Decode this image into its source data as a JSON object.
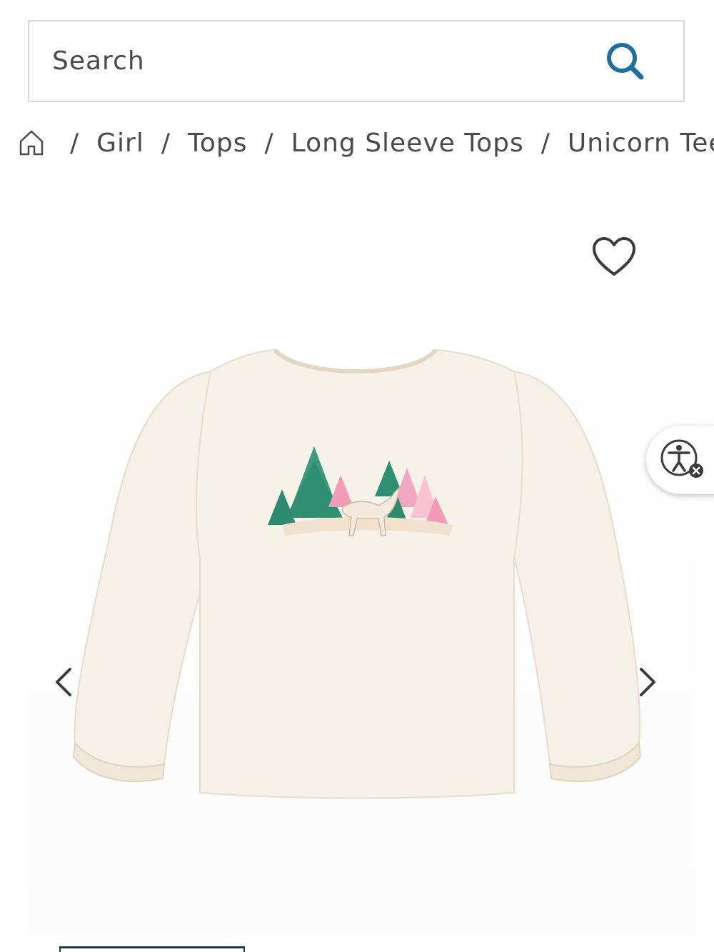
{
  "search": {
    "placeholder": "Search",
    "value": ""
  },
  "breadcrumb": {
    "home_icon": "home-icon",
    "items": [
      "Girl",
      "Tops",
      "Long Sleeve Tops",
      "Unicorn Tee"
    ],
    "separator": "/"
  },
  "product": {
    "wishlist_icon": "heart-outline-icon",
    "image_alt": "Unicorn Tee",
    "prev_icon": "chevron-left-icon",
    "next_icon": "chevron-right-icon"
  },
  "accessibility": {
    "icon": "accessibility-icon"
  },
  "colors": {
    "accent": "#1e6fa0",
    "text": "#4a4a4a",
    "border": "#d6d6d6",
    "shirt": "#f6f1e8"
  }
}
